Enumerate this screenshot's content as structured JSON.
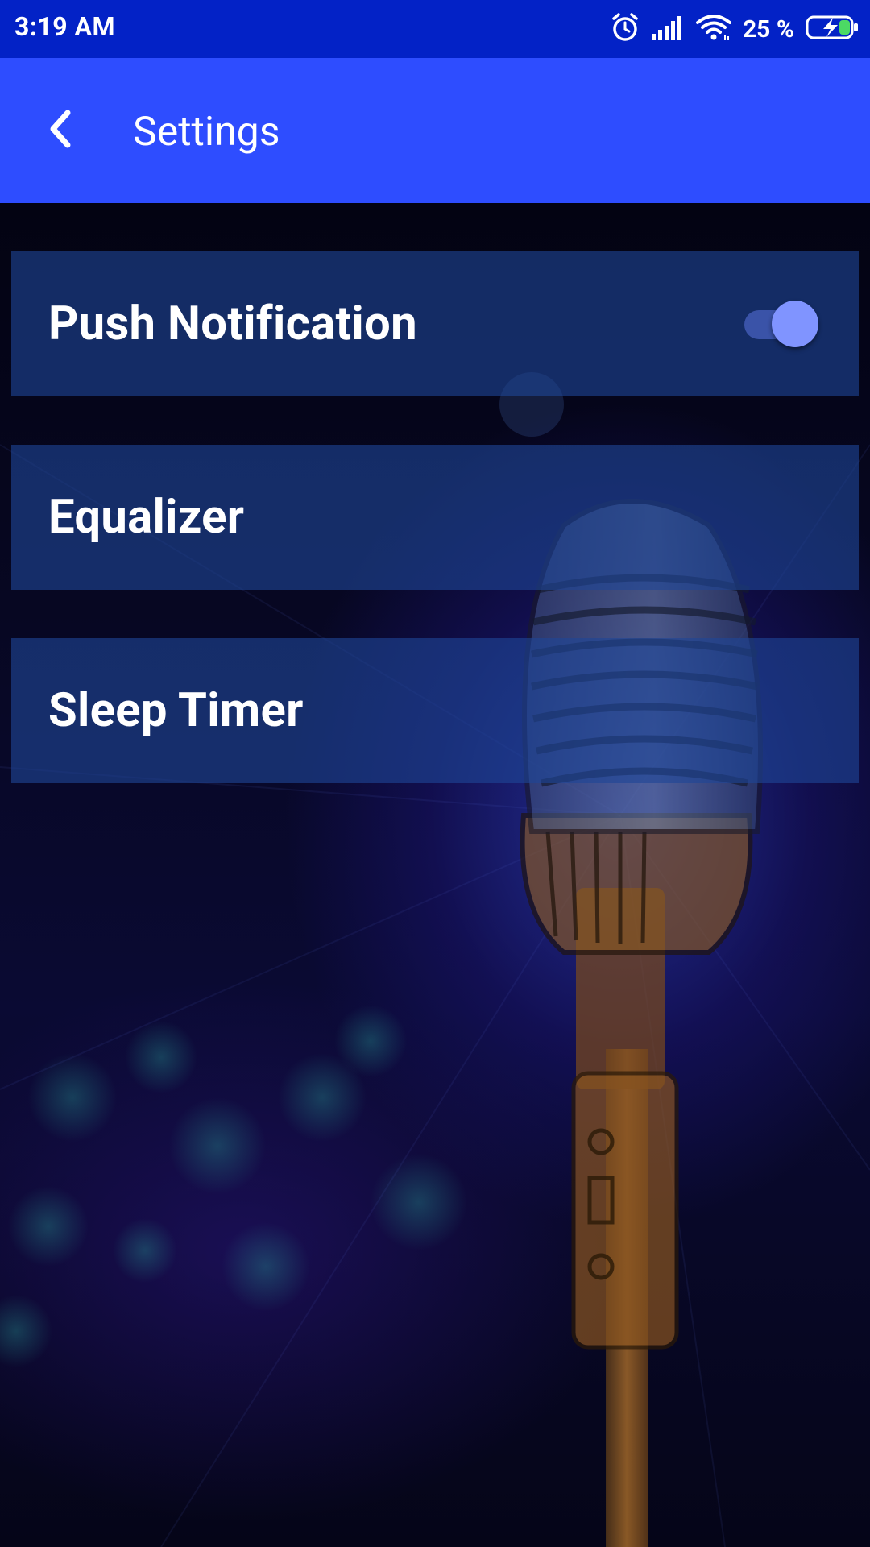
{
  "status_bar": {
    "time": "3:19 AM",
    "battery_text": "25 %",
    "icons": [
      "alarm-icon",
      "signal-icon",
      "wifi-icon",
      "battery-charging-icon"
    ]
  },
  "app_bar": {
    "title": "Settings",
    "back_icon": "chevron-left-icon"
  },
  "settings": {
    "items": [
      {
        "label": "Push Notification",
        "control": "toggle",
        "enabled": true
      },
      {
        "label": "Equalizer"
      },
      {
        "label": "Sleep Timer"
      }
    ]
  },
  "colors": {
    "status_bar": "#0322c6",
    "app_bar": "#2e4dff",
    "row_background": "rgba(30,70,150,0.62)",
    "toggle_thumb": "#8094ff",
    "toggle_track": "#3a53a8",
    "text": "#ffffff"
  },
  "background": {
    "image": "microphone-icon"
  }
}
